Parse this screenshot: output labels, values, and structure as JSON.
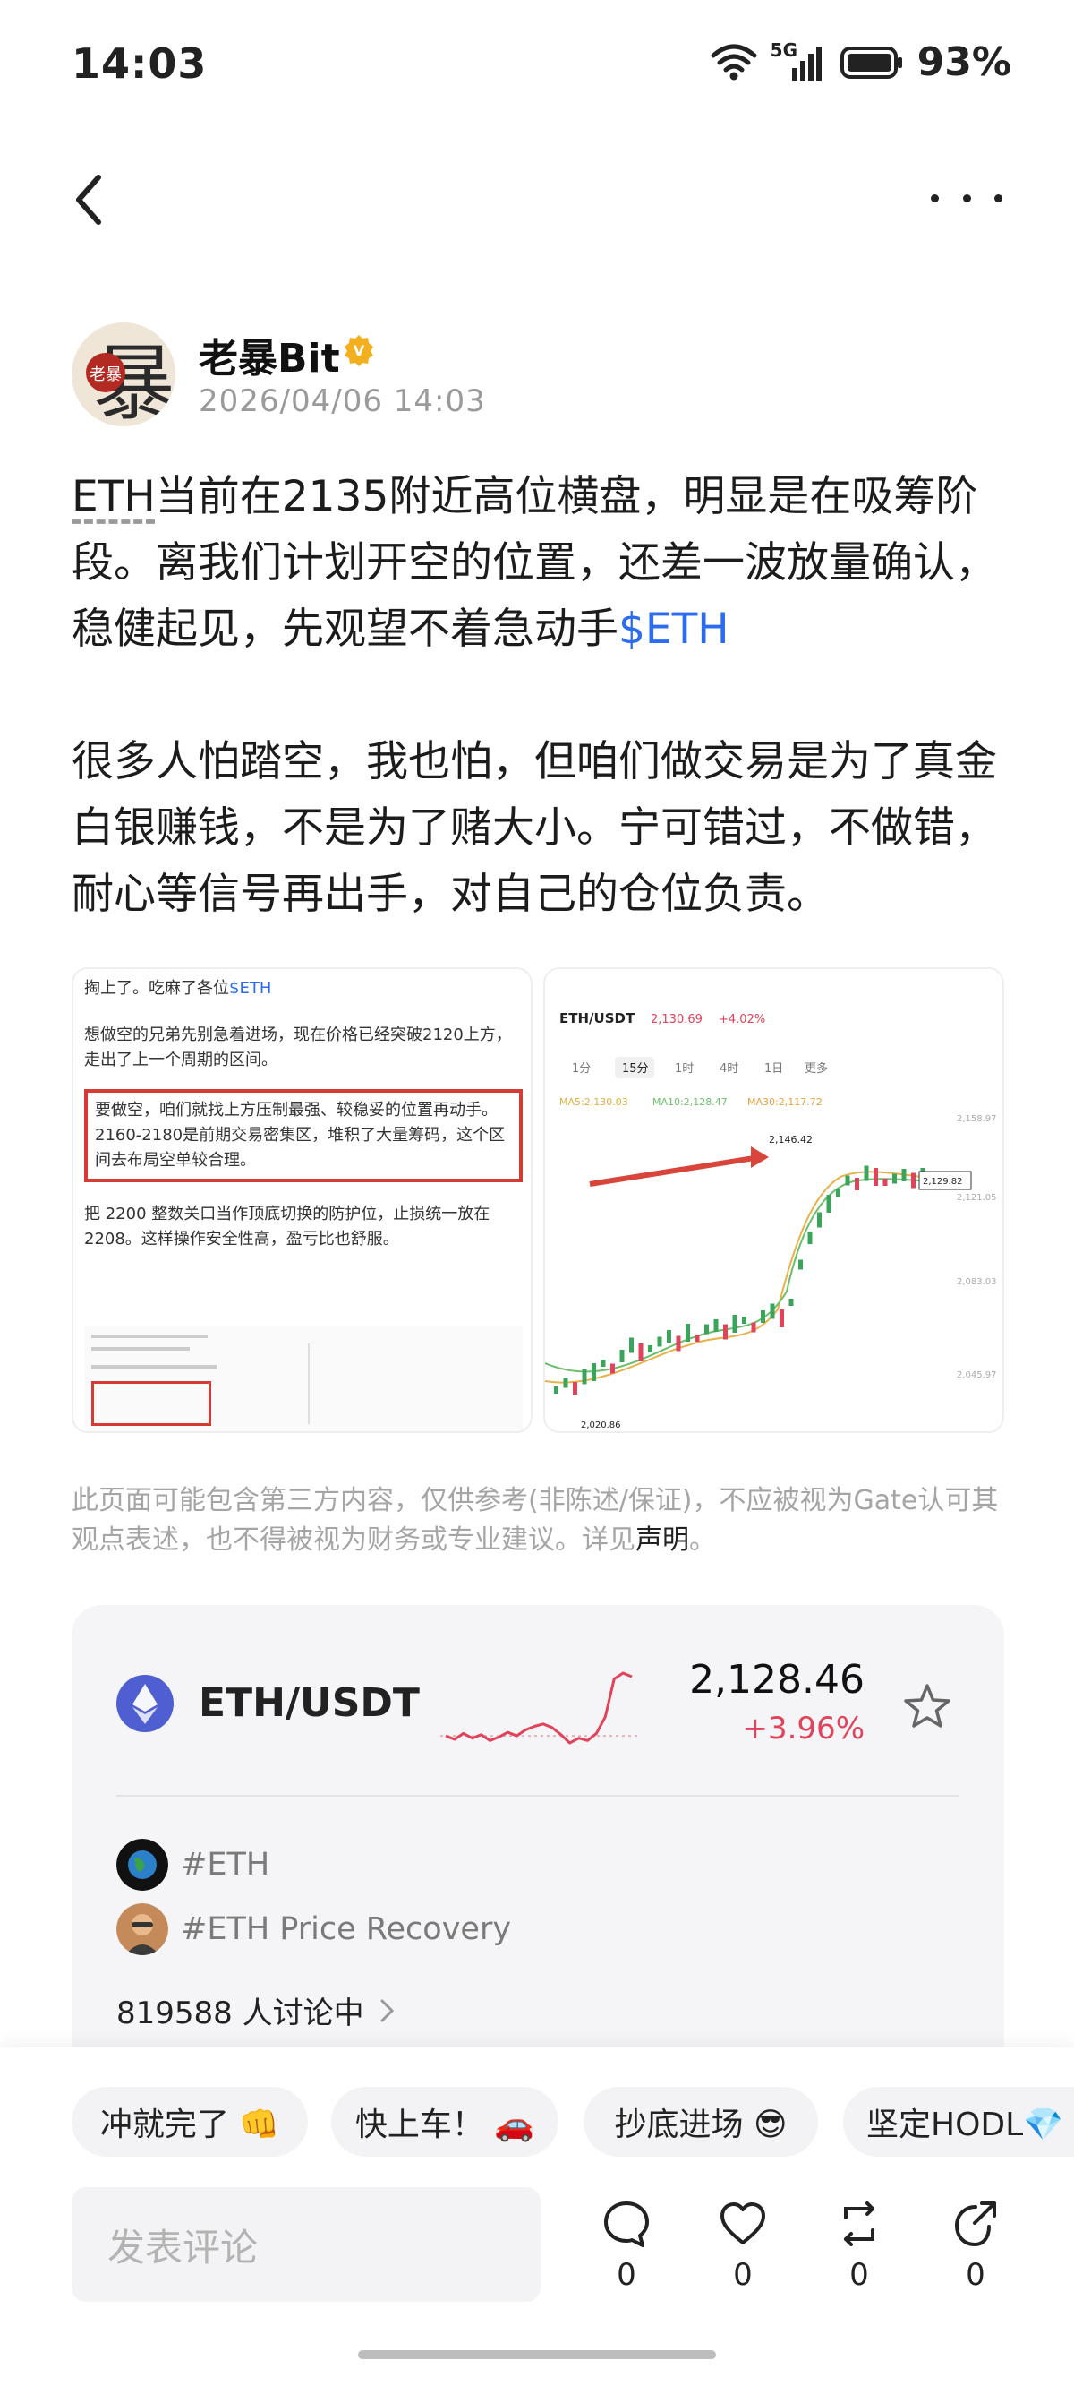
{
  "status_bar": {
    "time": "14:03",
    "network": "5G",
    "battery": "93%",
    "icons": [
      "wifi-icon",
      "signal-5g-icon",
      "battery-icon"
    ]
  },
  "nav": {
    "back_icon": "chevron-left-icon",
    "more_icon": "more-dots-icon"
  },
  "author": {
    "name": "老暴Bit",
    "avatar_text": "老暴",
    "avatar_big_char": "暴",
    "time": "2026/04/06 14:03",
    "badge_text": "V"
  },
  "post": {
    "p1_ticker": "ETH",
    "p1_text": "当前在2135附近高位横盘，明显是在吸筹阶段。离我们计划开空的位置，还差一波放量确认，稳健起见，先观望不着急动手",
    "p1_tag": "$ETH",
    "p2_text": "很多人怕踏空，我也怕，但咱们做交易是为了真金白银赚钱，不是为了赌大小。宁可错过，不做错，耐心等信号再出手，对自己的仓位负责。"
  },
  "image_left": {
    "line1": "掏上了。吃麻了各位",
    "line1_tag": "$ETH",
    "line2": "想做空的兄弟先别急着进场，现在价格已经突破2120上方，走出了上一个周期的区间。",
    "box_text": "要做空，咱们就找上方压制最强、较稳妥的位置再动手。2160-2180是前期交易密集区，堆积了大量筹码，这个区间去布局空单较合理。",
    "line3": "把 2200 整数关口当作顶底切换的防护位，止损统一放在 2208。这样操作安全性高，盈亏比也舒服。"
  },
  "image_right": {
    "pair": "ETH/USDT",
    "price": "2,130.69",
    "change": "+4.02%",
    "tabs": [
      "1分",
      "15分",
      "1时",
      "4时",
      "1日",
      "更多"
    ],
    "active_tab": "15分",
    "ma_labels": [
      "MA5:2,130.03",
      "MA10:2,128.47",
      "MA30:2,117.72"
    ],
    "high_label": "2,146.42",
    "current_label": "2,129.82",
    "y_ticks": [
      "2,158.97",
      "2,121.05",
      "2,083.03",
      "2,045.97"
    ],
    "low_label": "2,020.86"
  },
  "disclaimer": {
    "text": "此页面可能包含第三方内容，仅供参考(非陈述/保证)，不应被视为Gate认可其观点表述，也不得被视为财务或专业建议。详见",
    "link": "声明",
    "end": "。"
  },
  "market": {
    "pair": "ETH/USDT",
    "price": "2,128.46",
    "change": "+3.96%",
    "sparkline_values": [
      2078,
      2075,
      2080,
      2076,
      2079,
      2074,
      2077,
      2081,
      2078,
      2083,
      2086,
      2088,
      2085,
      2079,
      2072,
      2076,
      2074,
      2080,
      2094,
      2126,
      2131,
      2128
    ],
    "topics": [
      "#ETH",
      "#ETH Price Recovery"
    ],
    "discussing": "819588 人讨论中",
    "accent_up": "#e0435a"
  },
  "reactions": [
    {
      "label": "冲就完了 👊"
    },
    {
      "label": "快上车！ 🚗"
    },
    {
      "label": "抄底进场 😎"
    },
    {
      "label": "坚定HODL💎"
    }
  ],
  "comment": {
    "placeholder": "发表评论"
  },
  "actions": [
    {
      "name": "comment",
      "count": "0"
    },
    {
      "name": "like",
      "count": "0"
    },
    {
      "name": "repost",
      "count": "0"
    },
    {
      "name": "share",
      "count": "0"
    }
  ]
}
